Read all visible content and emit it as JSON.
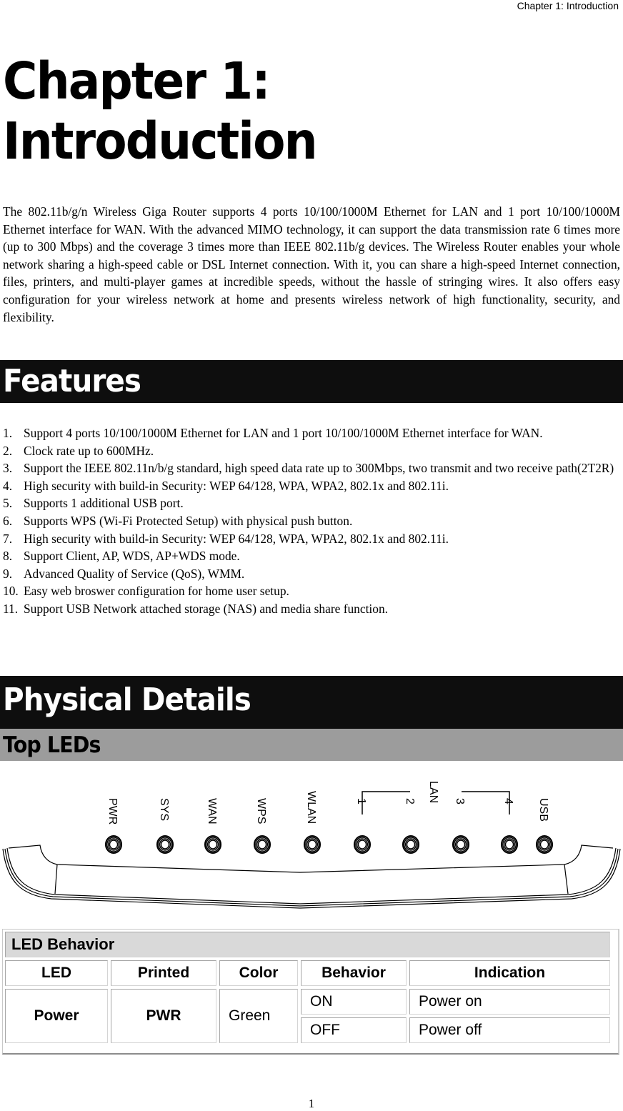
{
  "running_header": "Chapter 1: Introduction",
  "chapter_title_line1": "Chapter 1:",
  "chapter_title_line2": "Introduction",
  "intro_paragraph": "The 802.11b/g/n Wireless Giga Router supports 4 ports 10/100/1000M Ethernet for LAN and 1 port 10/100/1000M Ethernet interface for WAN. With the advanced MIMO technology, it can support the data transmission rate 6 times more (up to 300 Mbps) and the coverage 3 times more than IEEE 802.11b/g devices. The Wireless Router enables your whole network sharing a high-speed cable or DSL Internet connection. With it, you can share a high-speed Internet connection, files, printers, and multi-player games at incredible speeds, without the hassle of stringing wires. It also offers easy configuration for your wireless network at home and presents wireless network of high functionality, security, and flexibility.",
  "features": {
    "heading": "Features",
    "items": [
      {
        "num": "1.",
        "text": "Support 4 ports 10/100/1000M Ethernet for LAN and 1 port 10/100/1000M Ethernet interface for WAN."
      },
      {
        "num": "2.",
        "text": "Clock rate up to 600MHz."
      },
      {
        "num": "3.",
        "text": "Support the IEEE 802.11n/b/g standard, high speed data rate up to 300Mbps, two transmit and two receive path(2T2R)"
      },
      {
        "num": "4.",
        "text": "High security with build-in Security: WEP 64/128, WPA, WPA2, 802.1x and 802.11i."
      },
      {
        "num": "5.",
        "text": "Supports 1 additional USB port."
      },
      {
        "num": "6.",
        "text": "Supports WPS (Wi-Fi Protected Setup) with physical push button."
      },
      {
        "num": "7.",
        "text": "High security with build-in Security: WEP 64/128, WPA, WPA2, 802.1x and 802.11i."
      },
      {
        "num": "8.",
        "text": "Support Client, AP, WDS, AP+WDS mode."
      },
      {
        "num": "9.",
        "text": "Advanced Quality of Service (QoS), WMM."
      },
      {
        "num": "10.",
        "text": "Easy web broswer configuration for home user setup."
      },
      {
        "num": "11.",
        "text": "Support USB Network attached storage (NAS) and media share function."
      }
    ]
  },
  "physical_details": {
    "heading": "Physical Details",
    "subheading": "Top LEDs",
    "figure": {
      "led_labels": [
        "PWR",
        "SYS",
        "WAN",
        "WPS",
        "WLAN",
        "1",
        "2",
        "3",
        "4",
        "USB"
      ],
      "lan_group_label": "LAN"
    }
  },
  "led_table": {
    "caption": "LED Behavior",
    "headers": [
      "LED",
      "Printed",
      "Color",
      "Behavior",
      "Indication"
    ],
    "rows": [
      {
        "led": "Power",
        "printed": "PWR",
        "color": "Green",
        "states": [
          {
            "behavior": "ON",
            "indication": "Power on"
          },
          {
            "behavior": "OFF",
            "indication": "Power off"
          }
        ]
      }
    ]
  },
  "page_number": "1"
}
